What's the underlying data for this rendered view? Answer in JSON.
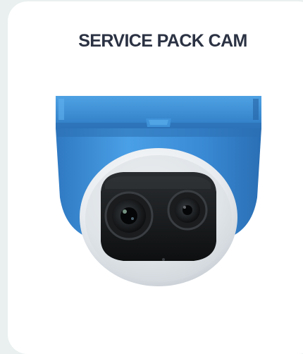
{
  "card": {
    "title": "SERVICE PACK CAM"
  },
  "colors": {
    "page_background": "#e9f0ef",
    "card_background": "#ffffff",
    "title_text": "#2b3243",
    "camera_housing": "#3d8fd8",
    "camera_bezel": "#e4e8ec",
    "camera_face": "#151718"
  },
  "icons": {
    "product_image": "dome-camera-illustration"
  }
}
